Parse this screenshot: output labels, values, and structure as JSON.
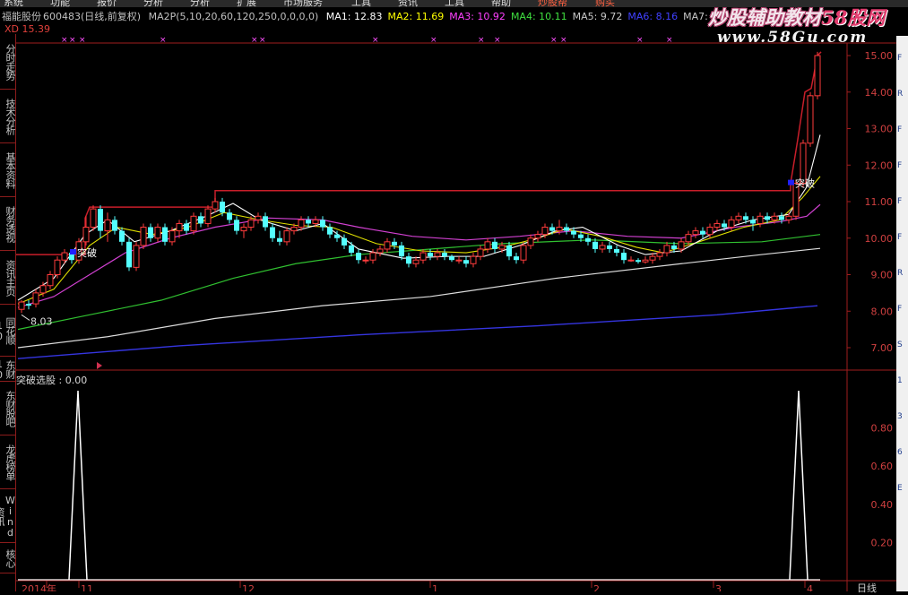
{
  "menu": [
    "系统",
    "功能",
    "报价",
    "分析",
    "分析",
    "扩展",
    "市场服务",
    "工具",
    "资讯",
    "工具",
    "帮助",
    "炒股帮",
    "购买"
  ],
  "header": {
    "stock_name": "福能股份",
    "code": "600483",
    "period": "(日线,前复权)",
    "indicator": "MA2P(5,10,20,60,120,250,0,0,0,0)",
    "ma": [
      {
        "label": "MA1:",
        "value": "12.83",
        "color": "#ffffff"
      },
      {
        "label": "MA2:",
        "value": "11.69",
        "color": "#ffff00"
      },
      {
        "label": "MA3:",
        "value": "10.92",
        "color": "#ff40ff"
      },
      {
        "label": "MA4:",
        "value": "10.11",
        "color": "#40e040"
      },
      {
        "label": "MA5:",
        "value": "9.72",
        "color": "#c8c8c8"
      },
      {
        "label": "MA6:",
        "value": "8.16",
        "color": "#4040ff"
      },
      {
        "label": "MA7:",
        "value": "-",
        "color": "#c8c8c8"
      }
    ],
    "xd_label": "XD 15.39"
  },
  "sidebar": [
    "分时走势",
    "技术分析",
    "基本资料",
    "财务透视",
    "资讯主页",
    "同花顺10",
    "东财10",
    "东财股吧",
    "龙虎榜单",
    "Wind资讯",
    "核心"
  ],
  "watermark": {
    "line1_a": "炒股辅助教材",
    "line1_b": "58股网",
    "line2": "www.58Gu.com"
  },
  "price_axis": [
    "15.00",
    "14.00",
    "13.00",
    "12.00",
    "11.00",
    "10.00",
    "9.00",
    "8.00",
    "7.00"
  ],
  "indicator_axis": [
    "0.80",
    "0.60",
    "0.40",
    "0.20"
  ],
  "indicator_title": "突破选股 : 0.00",
  "annotations": {
    "breakout1": "突破",
    "breakout2": "突破",
    "low_label": "8.03"
  },
  "bottom_labels": [
    "2014年",
    "11",
    "12",
    "1",
    "2",
    "3",
    "4"
  ],
  "period_label": "日线",
  "right_panel_icons": [
    "F",
    "R",
    "F",
    "F",
    "F",
    "F",
    "R",
    "F",
    "S",
    "1",
    "3",
    "6",
    "E"
  ]
}
